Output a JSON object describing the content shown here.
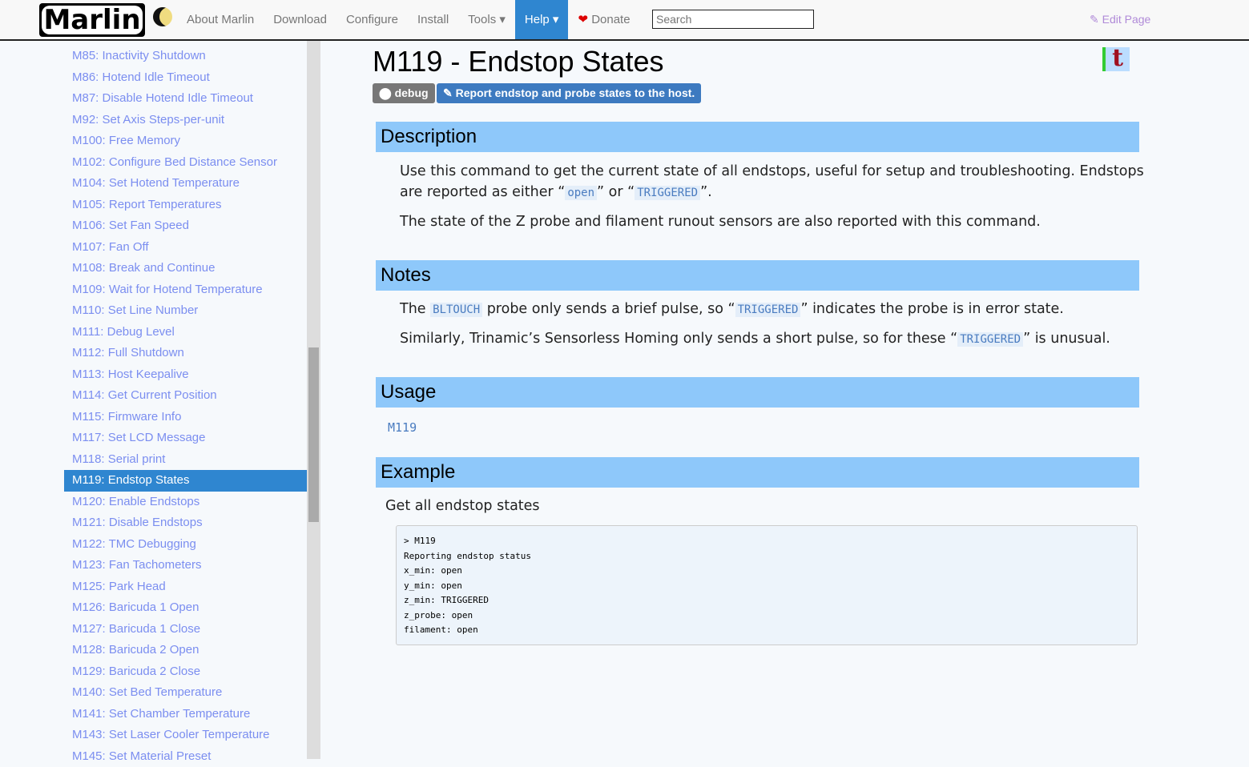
{
  "nav": {
    "logo": "Marlin",
    "items": [
      "About Marlin",
      "Download",
      "Configure",
      "Install",
      "Tools ▾",
      "Help ▾"
    ],
    "donate": "Donate",
    "search_placeholder": "Search",
    "edit": "Edit Page"
  },
  "sidebar": [
    "M85: Inactivity Shutdown",
    "M86: Hotend Idle Timeout",
    "M87: Disable Hotend Idle Timeout",
    "M92: Set Axis Steps-per-unit",
    "M100: Free Memory",
    "M102: Configure Bed Distance Sensor",
    "M104: Set Hotend Temperature",
    "M105: Report Temperatures",
    "M106: Set Fan Speed",
    "M107: Fan Off",
    "M108: Break and Continue",
    "M109: Wait for Hotend Temperature",
    "M110: Set Line Number",
    "M111: Debug Level",
    "M112: Full Shutdown",
    "M113: Host Keepalive",
    "M114: Get Current Position",
    "M115: Firmware Info",
    "M117: Set LCD Message",
    "M118: Serial print",
    "M119: Endstop States",
    "M120: Enable Endstops",
    "M121: Disable Endstops",
    "M122: TMC Debugging",
    "M123: Fan Tachometers",
    "M125: Park Head",
    "M126: Baricuda 1 Open",
    "M127: Baricuda 1 Close",
    "M128: Baricuda 2 Open",
    "M129: Baricuda 2 Close",
    "M140: Set Bed Temperature",
    "M141: Set Chamber Temperature",
    "M143: Set Laser Cooler Temperature",
    "M145: Set Material Preset"
  ],
  "page": {
    "title": "M119 - Endstop States",
    "tag": "debug",
    "summary": "Report endstop and probe states to the host.",
    "desc_h": "Description",
    "desc1a": "Use this command to get the current state of all endstops, useful for setup and troubleshooting. Endstops are reported as either “",
    "open": "open",
    "desc1b": "” or “",
    "trig": "TRIGGERED",
    "desc1c": "”.",
    "desc2": "The state of the Z probe and filament runout sensors are also reported with this command.",
    "notes_h": "Notes",
    "n1a": "The ",
    "bltouch": "BLTOUCH",
    "n1b": " probe only sends a brief pulse, so “",
    "n1c": "” indicates the probe is in error state.",
    "n2a": "Similarly, Trinamic’s Sensorless Homing only sends a short pulse, so for these “",
    "n2b": "” is unusual.",
    "usage_h": "Usage",
    "usage": "M119",
    "example_h": "Example",
    "example_desc": "Get all endstop states",
    "example_code": "> M119\nReporting endstop status\nx_min: open\ny_min: open\nz_min: TRIGGERED\nz_probe: open\nfilament: open"
  }
}
